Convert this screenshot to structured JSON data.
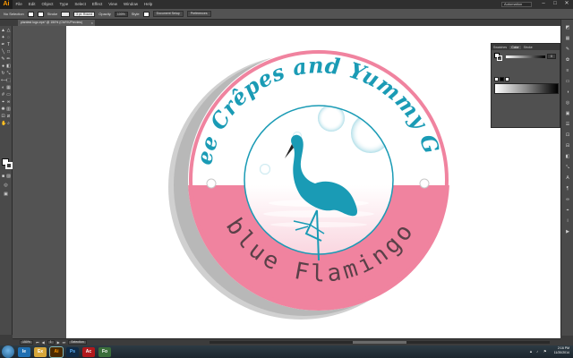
{
  "app": {
    "logo": "Ai"
  },
  "menu": [
    "File",
    "Edit",
    "Object",
    "Type",
    "Select",
    "Effect",
    "View",
    "Window",
    "Help"
  ],
  "workspace": "Automation",
  "window_controls": {
    "minimize": "–",
    "maximize": "□",
    "close": "✕"
  },
  "controlbar": {
    "selection": "No Selection",
    "stroke_label": "Stroke",
    "brush_field": "3 pt. Round",
    "opacity_label": "Opacity",
    "opacity_value": "100%",
    "style_label": "Style",
    "doc_setup": "Document Setup",
    "preferences": "Preferences"
  },
  "document_tab": {
    "title": "plantest logo.eps* @ 150% (CMYK/Preview)",
    "close": "×"
  },
  "color_panel": {
    "tabs": [
      "Swatches",
      "Color",
      "Stroke"
    ],
    "active_tab": "Color",
    "slider_value": "0",
    "colors": {
      "fill": "#ffffff",
      "stroke": "#ffffff"
    }
  },
  "artwork": {
    "arc_text": "Coffee Crêpes and Yummy Goods",
    "brand_text": "blue Flamingo",
    "colors": {
      "pink": "#f0839f",
      "teal": "#1a9bb5",
      "dark_teal": "#1e7d95",
      "ring": "#ffffff"
    }
  },
  "statusbar": {
    "zoom": "150%",
    "page": "1",
    "status": "Selection"
  },
  "taskbar": {
    "apps": [
      "Ie",
      "Ex",
      "Ai",
      "Ps",
      "Ac",
      "Fo"
    ],
    "time": "2:16 PM",
    "date": "11/20/2014"
  }
}
